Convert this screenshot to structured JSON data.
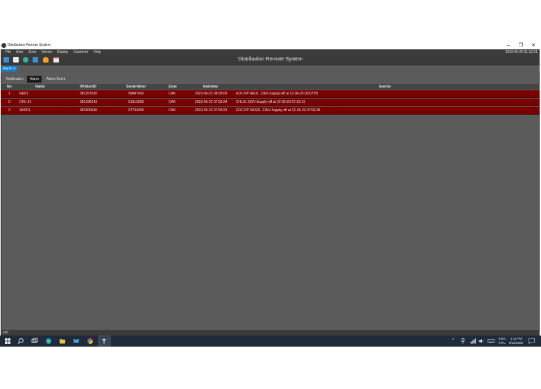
{
  "window": {
    "title": "Distribution Remote System",
    "controls": [
      "–",
      "❐",
      "✕"
    ]
  },
  "menu": {
    "items": [
      "File",
      "User",
      "Zone",
      "Device",
      "Display",
      "Customer",
      "Help"
    ],
    "datetime": "2023-06-22 01:12:51"
  },
  "header": {
    "title": "Distribution Remote System"
  },
  "toolbar": {
    "icons": [
      "monitor-icon",
      "document-icon",
      "network-icon",
      "list-icon",
      "bell-icon",
      "calendar-icon"
    ],
    "colors": {
      "blue": "#3b8fd6",
      "orange": "#f2a21b",
      "white": "#e9e9e9",
      "teal": "#2fb3a6"
    }
  },
  "doc_tab": {
    "label": "Alarm",
    "close": "✕",
    "color": "#0e7fd1"
  },
  "subtabs": [
    "Notification",
    "Alarm",
    "Alarm Event"
  ],
  "table": {
    "columns": [
      "No",
      "Name",
      "VP.StartID",
      "Serial Meter",
      "Zone",
      "Datetime",
      "Events"
    ],
    "rows": [
      [
        "1",
        "RE01",
        "081257530",
        "99847430",
        "CAK",
        "2023-06-22 08:08:00",
        "EDC-PP RE01.  22kV-Supply-off at 22-06-23 08:07:55"
      ],
      [
        "2",
        "CHL-01",
        "081336143",
        "51313026",
        "CAK",
        "2023-06-22 07:59:24",
        "CHL01  22kV-Supply-off at 22-06-23 07:59:19"
      ],
      [
        "3",
        "SKS01",
        "081569640",
        "97734405",
        "CAK",
        "2023-06-22 07:59:23",
        "EDC-PP SKS01.  22kV-Supply-off at 22-06-23 07:59:18"
      ]
    ],
    "row_color": "#7a0000"
  },
  "status": {
    "text": "edc"
  },
  "taskbar": {
    "lang_top": "ENG",
    "lang_bottom": "INTL",
    "time": "1:12 PM",
    "date": "6/22/2023"
  }
}
